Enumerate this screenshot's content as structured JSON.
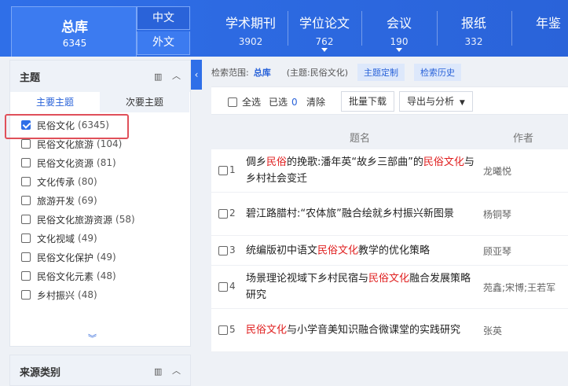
{
  "header": {
    "all_db": {
      "label": "总库",
      "count": "6345"
    },
    "lang_cn": "中文",
    "lang_foreign": "外文",
    "tabs": [
      {
        "label": "学术期刊",
        "count": "3902"
      },
      {
        "label": "学位论文",
        "count": "762"
      },
      {
        "label": "会议",
        "count": "190"
      },
      {
        "label": "报纸",
        "count": "332"
      },
      {
        "label": "年鉴",
        "count": ""
      }
    ]
  },
  "sidebar": {
    "topic_title": "主题",
    "subtabs": [
      "主要主题",
      "次要主题"
    ],
    "facets": [
      {
        "label": "民俗文化",
        "count": "(6345)",
        "checked": true
      },
      {
        "label": "民俗文化旅游",
        "count": "(104)",
        "checked": false
      },
      {
        "label": "民俗文化资源",
        "count": "(81)",
        "checked": false
      },
      {
        "label": "文化传承",
        "count": "(80)",
        "checked": false
      },
      {
        "label": "旅游开发",
        "count": "(69)",
        "checked": false
      },
      {
        "label": "民俗文化旅游资源",
        "count": "(58)",
        "checked": false
      },
      {
        "label": "文化视域",
        "count": "(49)",
        "checked": false
      },
      {
        "label": "民俗文化保护",
        "count": "(49)",
        "checked": false
      },
      {
        "label": "民俗文化元素",
        "count": "(48)",
        "checked": false
      },
      {
        "label": "乡村振兴",
        "count": "(48)",
        "checked": false
      }
    ],
    "source_title": "来源类别"
  },
  "scope": {
    "label": "检索范围:",
    "db": "总库",
    "theme": "(主题:民俗文化)",
    "btn_custom": "主题定制",
    "btn_history": "检索历史"
  },
  "toolbar": {
    "select_all": "全选",
    "selected_label": "已选",
    "selected_count": "0",
    "clear": "清除",
    "batch_download": "批量下载",
    "export": "导出与分析"
  },
  "table": {
    "col_title": "题名",
    "col_author": "作者",
    "rows": [
      {
        "num": "1",
        "title": [
          "倜乡",
          "民俗",
          "的挽歌:潘年英“故乡三部曲”的",
          "民俗文化",
          "与乡村社会变迁"
        ],
        "author": "龙曦悦"
      },
      {
        "num": "2",
        "title": [
          "碧江路腊村:“农体旅”融合绘就乡村振兴新图景"
        ],
        "author": "杨铜琴"
      },
      {
        "num": "3",
        "title": [
          "统编版初中语文",
          "民俗文化",
          "教学的优化策略"
        ],
        "author": "顾亚琴"
      },
      {
        "num": "4",
        "title": [
          "场景理论视域下乡村民宿与",
          "民俗文化",
          "融合发展策略研究"
        ],
        "author": "苑鑫;宋博;王若军"
      },
      {
        "num": "5",
        "title": [
          "",
          "民俗文化",
          "与小学音美知识融合微课堂的实践研究"
        ],
        "author": "张英"
      }
    ]
  },
  "colors": {
    "accent": "#2f6fe8",
    "highlight": "#e02020",
    "outline": "#e0505a"
  }
}
